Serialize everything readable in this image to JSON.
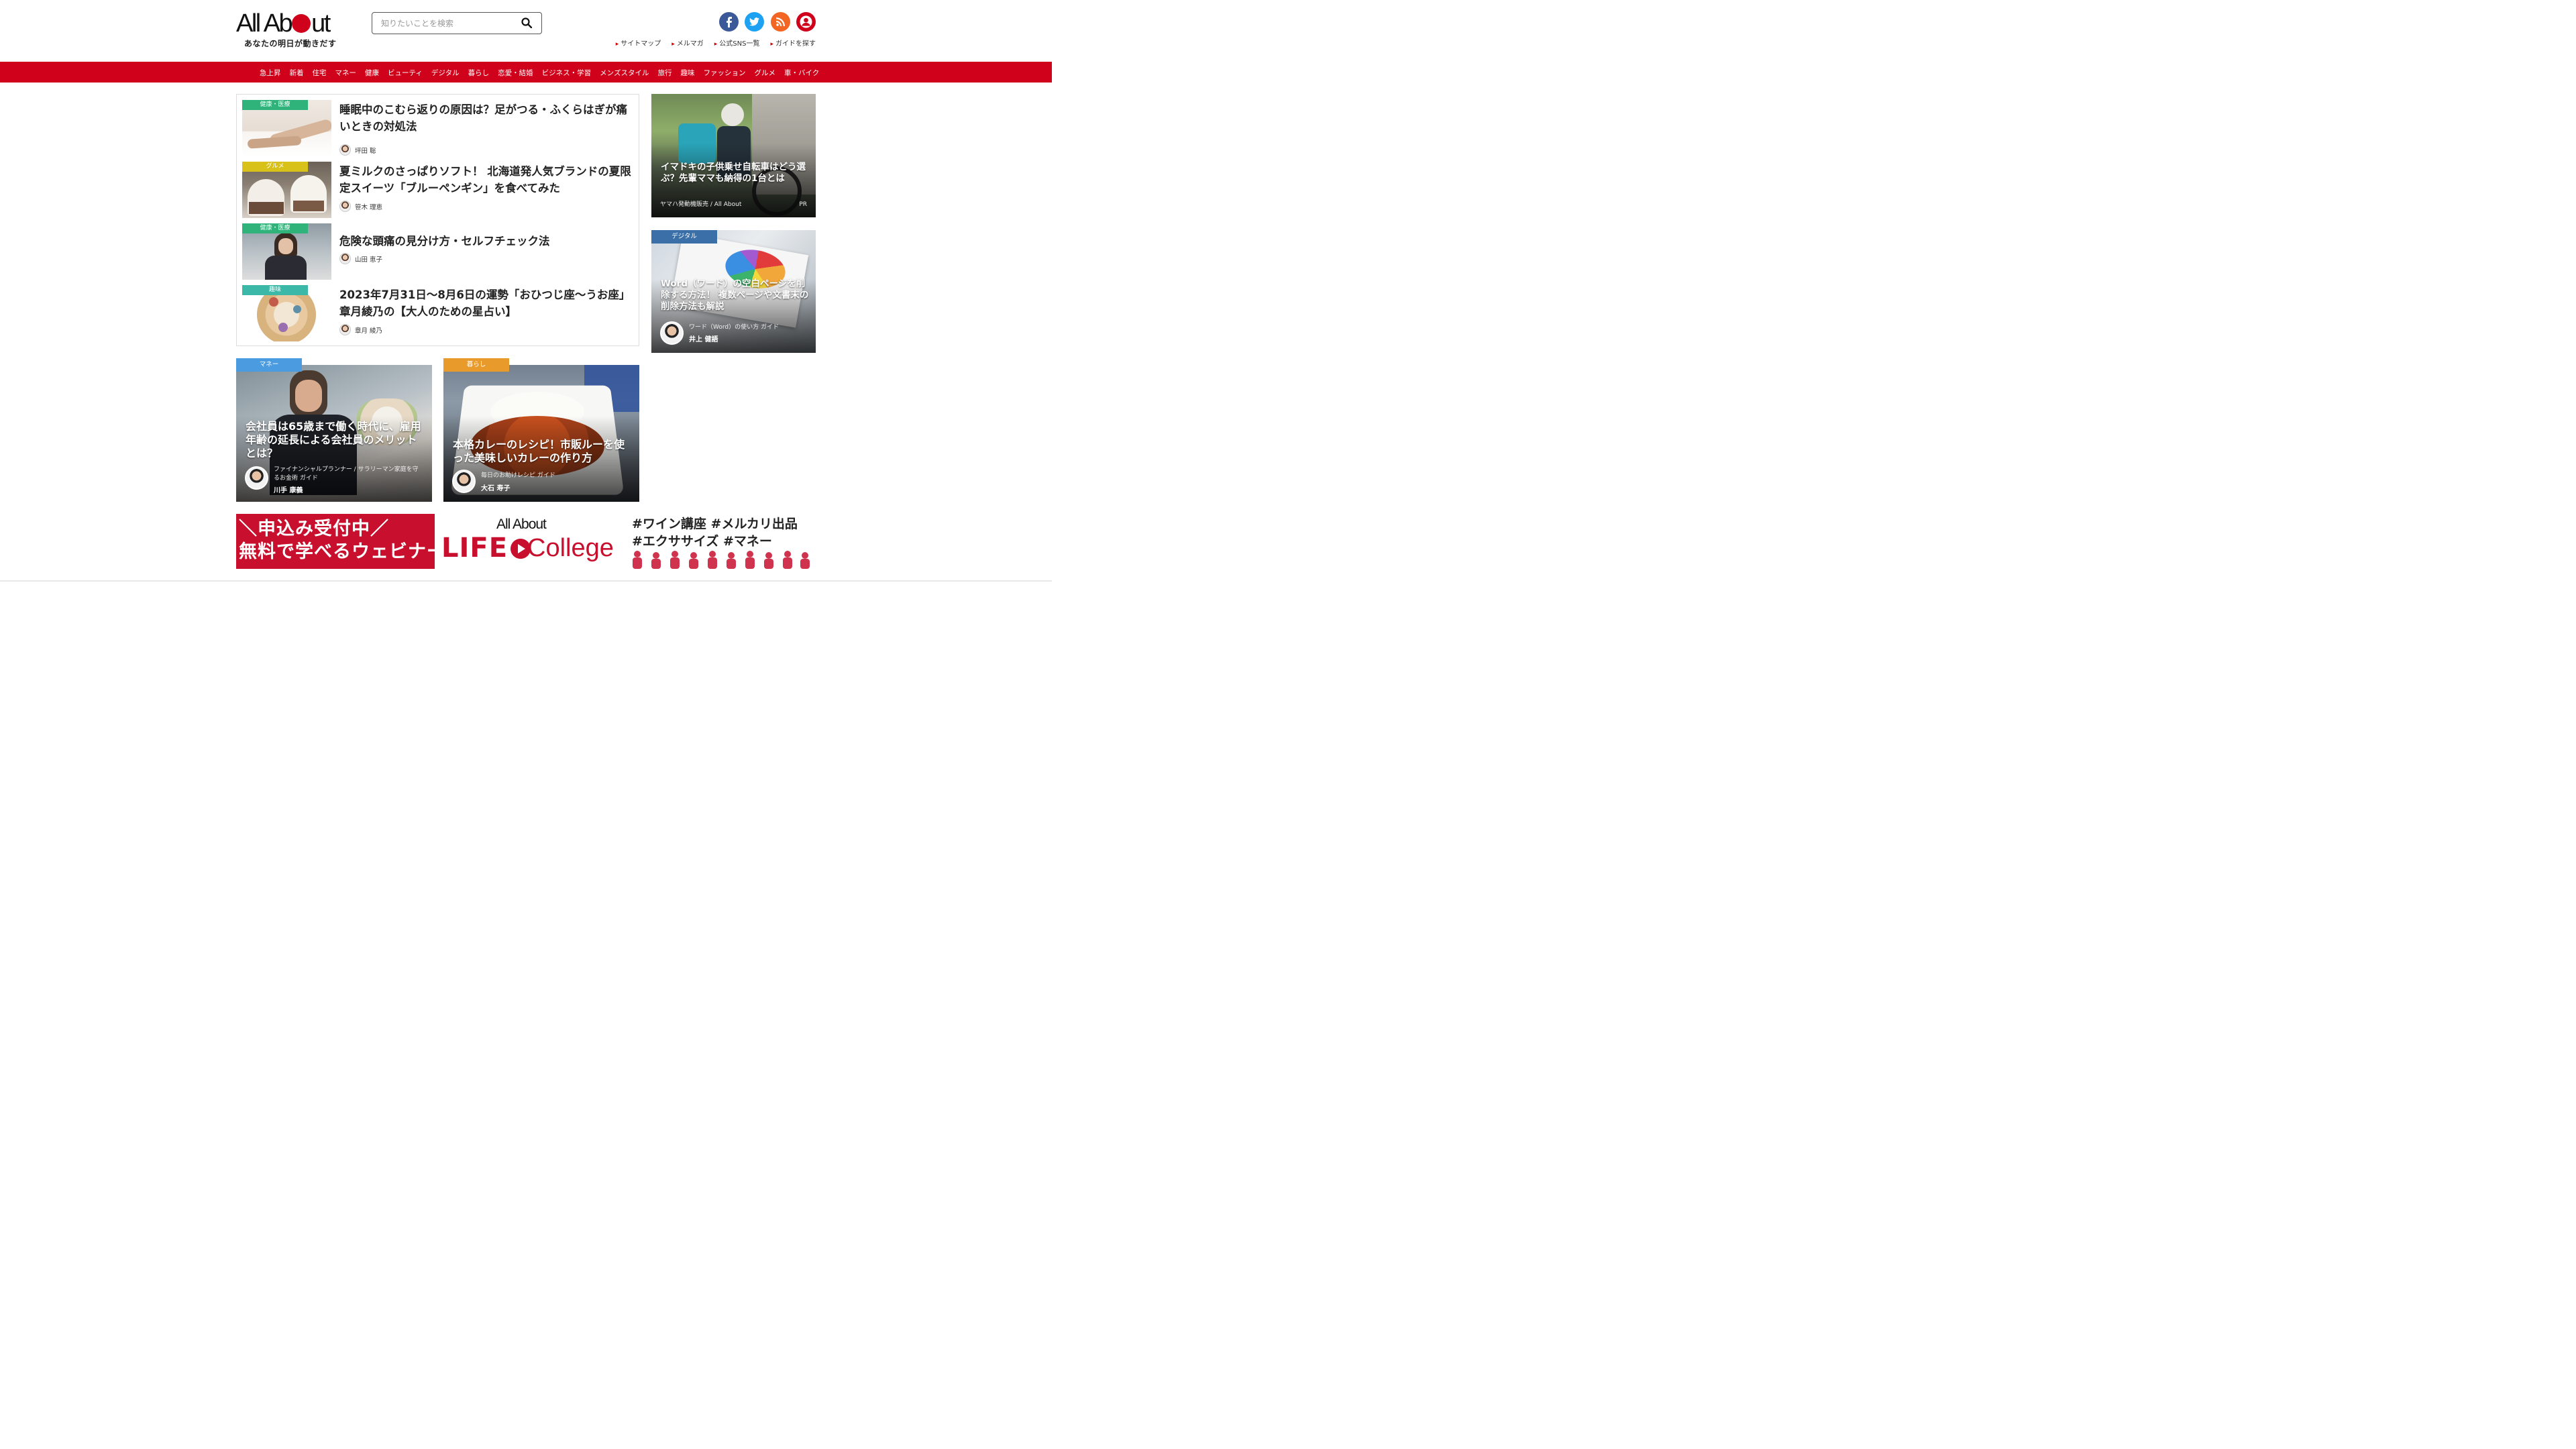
{
  "header": {
    "logo_text": "All About",
    "tagline": "あなたの明日が動きだす",
    "search_placeholder": "知りたいことを検索",
    "sns": [
      {
        "icon": "facebook-icon",
        "color": "#3b5998",
        "glyph": "f"
      },
      {
        "icon": "twitter-icon",
        "color": "#1da1f2",
        "glyph": "t"
      },
      {
        "icon": "rss-icon",
        "color": "#f26522",
        "glyph": "r"
      },
      {
        "icon": "user-icon",
        "color": "#d0021b",
        "glyph": "u"
      }
    ],
    "links": [
      "サイトマップ",
      "メルマガ",
      "公式SNS一覧",
      "ガイドを探す"
    ]
  },
  "nav": [
    "急上昇",
    "新着",
    "住宅",
    "マネー",
    "健康",
    "ビューティ",
    "デジタル",
    "暮らし",
    "恋愛・結婚",
    "ビジネス・学習",
    "メンズスタイル",
    "旅行",
    "趣味",
    "ファッション",
    "グルメ",
    "車・バイク"
  ],
  "articles": [
    {
      "category": "健康・医療",
      "cat_color": "#2fb37a",
      "title": "睡眠中のこむら返りの原因は？足がつる・ふくらはぎが痛いときの対処法",
      "author": "坪田 聡"
    },
    {
      "category": "グルメ",
      "cat_color": "#d8c21a",
      "title": "夏ミルクのさっぱりソフト！ 北海道発人気ブランドの夏限定スイーツ「ブルーペンギン」を食べてみた",
      "author": "笹木 理恵"
    },
    {
      "category": "健康・医療",
      "cat_color": "#2fb37a",
      "title": "危険な頭痛の見分け方・セルフチェック法",
      "author": "山田 恵子"
    },
    {
      "category": "趣味",
      "cat_color": "#3cb8a8",
      "title": "2023年7月31日～8月6日の運勢「おひつじ座～うお座」 章月綾乃の【大人のための星占い】",
      "author": "章月 綾乃"
    }
  ],
  "cards": {
    "money": {
      "category": "マネー",
      "cat_color": "#4a9be0",
      "title": "会社員は65歳まで働く時代に、雇用年齢の延長による会社員のメリットとは？",
      "guide": "ファイナンシャルプランナー / サラリーマン家庭を守るお金術 ガイド",
      "name": "川手 康義"
    },
    "life": {
      "category": "暮らし",
      "cat_color": "#e89a2a",
      "title": "本格カレーのレシピ！市販ルーを使った美味しいカレーの作り方",
      "guide": "毎日のお助けレシピ ガイド",
      "name": "大石 寿子"
    },
    "pr": {
      "title": "イマドキの子供乗せ自転車はどう選ぶ？先輩ママも納得の1台とは",
      "sponsor": "ヤマハ発動機販売 / All About",
      "pr_label": "PR"
    },
    "digital": {
      "category": "デジタル",
      "cat_color": "#3a6fa8",
      "title": "Word（ワード）の空白ページを削除する方法！ 複数ページや文書末の削除方法も解説",
      "guide": "ワード（Word）の使い方 ガイド",
      "name": "井上 健語"
    }
  },
  "banner": {
    "line1": "＼申込み受付中／",
    "line2": "無料で学べるウェビナー",
    "brand": "All About",
    "life": "LIFE",
    "college": "College",
    "tags1": "#ワイン講座  #メルカリ出品",
    "tags2": "#エクササイズ  #マネー"
  }
}
